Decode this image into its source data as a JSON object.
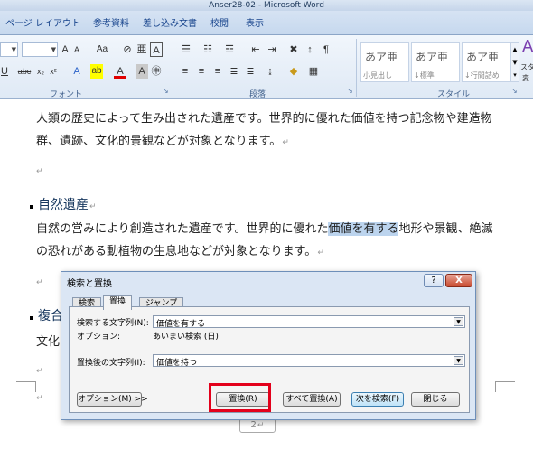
{
  "window": {
    "title": "Anser28-02 - Microsoft Word"
  },
  "ribbon_tabs": [
    "ページ レイアウト",
    "参考資料",
    "差し込み文書",
    "校閲",
    "表示"
  ],
  "ribbon": {
    "font_group_label": "フォント",
    "paragraph_group_label": "段落",
    "styles_group_label": "スタイル",
    "style_gallery": [
      {
        "sample": "あア亜",
        "name": "小見出し"
      },
      {
        "sample": "あア亜",
        "name": "↓標準"
      },
      {
        "sample": "あア亜",
        "name": "↓行間詰め"
      }
    ],
    "style_more_label": "スタ",
    "style_more_label2": "変"
  },
  "document": {
    "para1_line1": "人類の歴史によって生み出された遺産です。世界的に優れた価値を持つ記念物や建造物",
    "para1_line2": "群、遺跡、文化的景観などが対象となります。",
    "heading_natural": "自然遺産",
    "para2_line1_a": "自然の営みにより創造された遺産です。世界的に優れた",
    "para2_line1_hl": "価値を有する",
    "para2_line1_b": "地形や景観、絶滅",
    "para2_line2": "の恐れがある動植物の生息地などが対象となります。",
    "heading_partial": "複合",
    "para3_partial": "文化",
    "return_mark": "↵",
    "page_number": "2"
  },
  "dialog": {
    "title": "検索と置換",
    "help_button": "?",
    "close_button": "X",
    "tabs": [
      "検索",
      "置換",
      "ジャンプ"
    ],
    "active_tab": "置換",
    "find_label": "検索する文字列(N):",
    "find_value": "価値を有する",
    "options_label": "オプション:",
    "options_value": "あいまい検索 (日)",
    "replace_label": "置換後の文字列(I):",
    "replace_value": "価値を持つ",
    "options_button": "オプション(M) >>",
    "replace_button": "置換(R)",
    "replace_all_button": "すべて置換(A)",
    "find_next_button": "次を検索(F)",
    "close_dialog_button": "閉じる"
  },
  "highlight_color": "#e3001b"
}
